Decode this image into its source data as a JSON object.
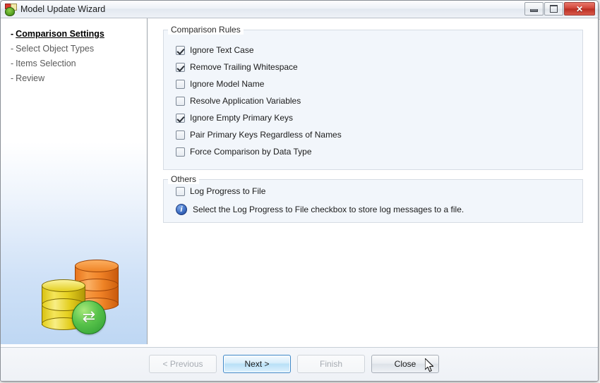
{
  "window": {
    "title": "Model Update Wizard",
    "app_icon": "wizard-icon",
    "controls": {
      "minimize": "minimize-icon",
      "maximize": "maximize-icon",
      "close": "✕"
    }
  },
  "sidebar": {
    "steps": [
      {
        "dash": "-",
        "label": "Comparison Settings",
        "active": true
      },
      {
        "dash": "-",
        "label": "Select Object Types",
        "active": false
      },
      {
        "dash": "-",
        "label": "Items Selection",
        "active": false
      },
      {
        "dash": "-",
        "label": "Review",
        "active": false
      }
    ],
    "artwork": {
      "name": "database-sync-illustration",
      "sync_glyph": "⇄"
    }
  },
  "content": {
    "groups": [
      {
        "id": "comparison-rules",
        "label": "Comparison Rules",
        "options": [
          {
            "label": "Ignore Text Case",
            "checked": true
          },
          {
            "label": "Remove Trailing Whitespace",
            "checked": true
          },
          {
            "label": "Ignore Model Name",
            "checked": false
          },
          {
            "label": "Resolve Application Variables",
            "checked": false
          },
          {
            "label": "Ignore Empty Primary Keys",
            "checked": true
          },
          {
            "label": "Pair Primary Keys Regardless of Names",
            "checked": false
          },
          {
            "label": "Force Comparison by Data Type",
            "checked": false
          }
        ]
      },
      {
        "id": "others",
        "label": "Others",
        "options": [
          {
            "label": "Log Progress to File",
            "checked": false
          }
        ],
        "info": {
          "icon": "i",
          "text": "Select the Log Progress to File checkbox to store log messages to a file."
        }
      }
    ]
  },
  "footer": {
    "buttons": [
      {
        "id": "previous",
        "label": "< Previous",
        "state": "disabled"
      },
      {
        "id": "next",
        "label": "Next >",
        "state": "hovered"
      },
      {
        "id": "finish",
        "label": "Finish",
        "state": "disabled"
      },
      {
        "id": "close",
        "label": "Close",
        "state": "normal"
      }
    ]
  },
  "colors": {
    "accent": "#3b87c8",
    "close_button": "#d1463a",
    "info_icon": "#3f6fc4",
    "panel": "#f2f6fb"
  }
}
